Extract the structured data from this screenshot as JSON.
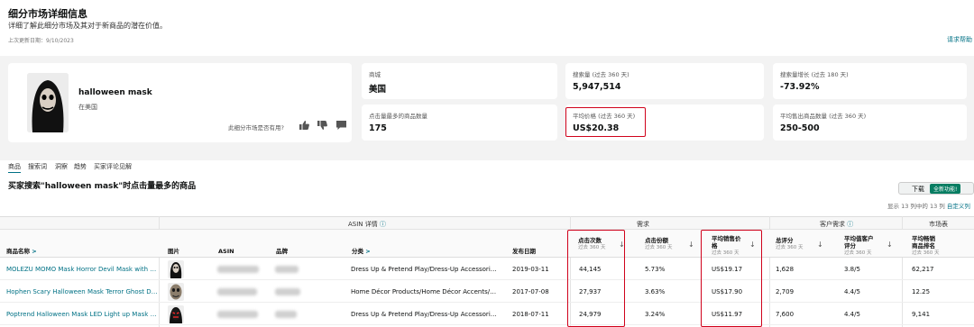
{
  "header": {
    "title": "细分市场详细信息",
    "subtitle": "详细了解此细分市场及其对于新商品的潜在价值。",
    "updated": "上次更新日期：9/10/2023",
    "link": "请求帮助"
  },
  "product": {
    "name": "halloween mask",
    "market": "在美国",
    "useful_question": "此细分市场是否有用?"
  },
  "stats": [
    {
      "label": "商城",
      "value": "美国"
    },
    {
      "label": "搜索量 (过去 360 天)",
      "value": "5,947,514"
    },
    {
      "label": "搜索量增长 (过去 180 天)",
      "value": "-73.92%"
    },
    {
      "label": "点击量最多的商品数量",
      "value": "175"
    },
    {
      "label": "平均价格 (过去 360 天)",
      "value": "US$20.38"
    },
    {
      "label": "平均售出商品数量 (过去 360 天)",
      "value": "250-500"
    }
  ],
  "tabs": [
    "商品",
    "搜索词",
    "洞察",
    "趋势",
    "买家评论见解"
  ],
  "section": {
    "title": "买家搜索\"halloween mask\"时点击量最多的商品",
    "download": "下载",
    "new_feature": "全新功能!",
    "count_text": "显示 13 列中的 13 列",
    "custom": "自定义列"
  },
  "groups": {
    "asin": "ASIN 详情",
    "demand": "需求",
    "customer": "客户需求",
    "market": "市场表"
  },
  "columns": {
    "product_name": "商品名称",
    "image": "图片",
    "asin": "ASIN",
    "brand": "品牌",
    "category": "分类",
    "launch": "发布日期",
    "clicks": "点击次数",
    "click_share": "点击份额",
    "avg_price_l1": "平均销售价",
    "avg_price_l2": "格",
    "reviews": "总评分",
    "rating_l1": "平均值客户",
    "rating_l2": "评分",
    "bsr_l1": "平均畅销",
    "bsr_l2": "商品排名",
    "sub": "过去 360 天"
  },
  "rows": [
    {
      "name": "MOLEZU MOMO Mask Horror Devil Mask with Lo...",
      "category": "Dress Up & Pretend Play/Dress-Up Accessories/M...",
      "date": "2019-03-11",
      "clicks": "44,145",
      "share": "5.73%",
      "price": "US$19.17",
      "reviews": "1,628",
      "rating": "3.8/5",
      "bsr": "62,217"
    },
    {
      "name": "Hophen Scary Halloween Mask Terror Ghost Devi...",
      "category": "Home Décor Products/Home Décor Accents/Dec...",
      "date": "2017-07-08",
      "clicks": "27,937",
      "share": "3.63%",
      "price": "US$17.90",
      "reviews": "2,709",
      "rating": "4.4/5",
      "bsr": "12.25"
    },
    {
      "name": "Poptrend Halloween Mask LED Light up Mask for...",
      "category": "Dress Up & Pretend Play/Dress-Up Accessories/M...",
      "date": "2018-07-11",
      "clicks": "24,979",
      "share": "3.24%",
      "price": "US$11.97",
      "reviews": "7,600",
      "rating": "4.4/5",
      "bsr": "9,141"
    }
  ]
}
